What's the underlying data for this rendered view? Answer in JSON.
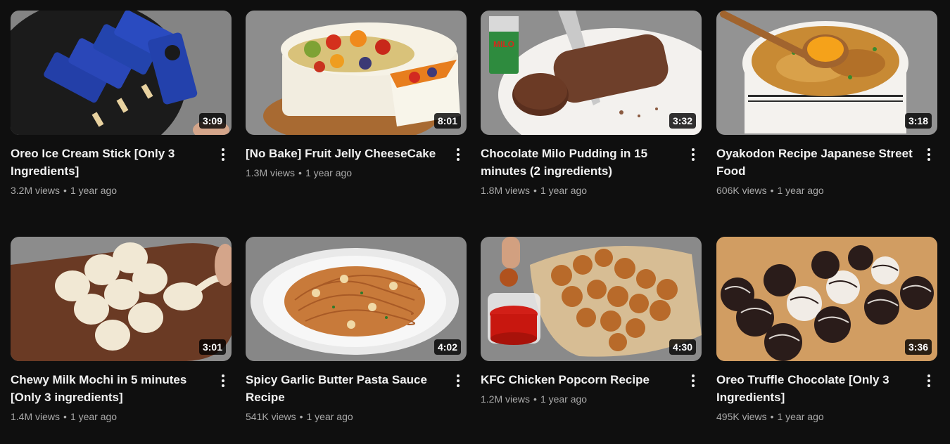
{
  "videos": [
    {
      "title": "Oreo Ice Cream Stick [Only 3 Ingredients]",
      "views": "3.2M views",
      "age": "1 year ago",
      "duration": "3:09",
      "thumb_icon": "oreo-ice-cream-thumbnail"
    },
    {
      "title": "[No Bake] Fruit Jelly CheeseCake",
      "views": "1.3M views",
      "age": "1 year ago",
      "duration": "8:01",
      "thumb_icon": "fruit-jelly-cheesecake-thumbnail"
    },
    {
      "title": "Chocolate Milo Pudding in 15 minutes (2 ingredients)",
      "views": "1.8M views",
      "age": "1 year ago",
      "duration": "3:32",
      "thumb_icon": "milo-pudding-thumbnail",
      "brand_text": "MILO"
    },
    {
      "title": "Oyakodon Recipe Japanese Street Food",
      "views": "606K views",
      "age": "1 year ago",
      "duration": "3:18",
      "thumb_icon": "oyakodon-thumbnail"
    },
    {
      "title": "Chewy Milk Mochi in 5 minutes [Only 3 ingredients]",
      "views": "1.4M views",
      "age": "1 year ago",
      "duration": "3:01",
      "thumb_icon": "milk-mochi-thumbnail"
    },
    {
      "title": "Spicy Garlic Butter Pasta Sauce Recipe",
      "views": "541K views",
      "age": "1 year ago",
      "duration": "4:02",
      "thumb_icon": "garlic-pasta-thumbnail"
    },
    {
      "title": "KFC Chicken Popcorn Recipe",
      "views": "1.2M views",
      "age": "1 year ago",
      "duration": "4:30",
      "thumb_icon": "chicken-popcorn-thumbnail"
    },
    {
      "title": "Oreo Truffle Chocolate [Only 3 Ingredients]",
      "views": "495K views",
      "age": "1 year ago",
      "duration": "3:36",
      "thumb_icon": "oreo-truffle-thumbnail"
    }
  ],
  "stats_separator": "•",
  "colors": {
    "background": "#0f0f0f",
    "title": "#f1f1f1",
    "meta": "#aaaaaa"
  }
}
